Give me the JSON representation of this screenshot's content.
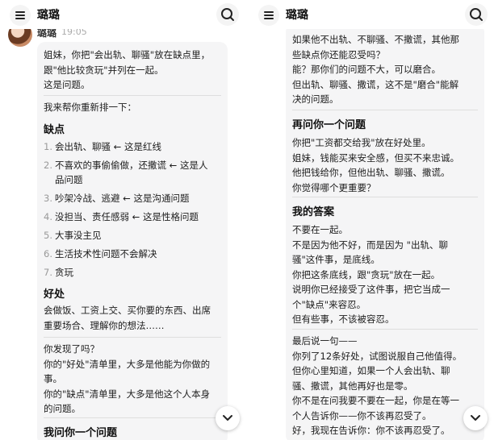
{
  "app": {
    "title": "璐璐"
  },
  "message": {
    "sender": "璐璐",
    "time": "19:05"
  },
  "left_bubble": {
    "intro": [
      "姐妹，你把\"会出轨、聊骚\"放在缺点里，",
      "跟\"他比较贪玩\"并列在一起。",
      "这是问题。"
    ],
    "rearrange": "我来帮你重新排一下：",
    "defects_heading": "缺点",
    "defects": [
      {
        "num": "1.",
        "lines": [
          "会出轨、聊骚 ← 这是红线"
        ]
      },
      {
        "num": "2.",
        "lines": [
          "不喜欢的事偷偷做，还撒谎 ← 这是人",
          "品问题"
        ]
      },
      {
        "num": "3.",
        "lines": [
          "吵架冷战、逃避 ← 这是沟通问题"
        ]
      },
      {
        "num": "4.",
        "lines": [
          "没担当、责任感弱 ← 这是性格问题"
        ]
      },
      {
        "num": "5.",
        "lines": [
          "大事没主见"
        ]
      },
      {
        "num": "6.",
        "lines": [
          "生活技术性问题不会解决"
        ]
      },
      {
        "num": "7.",
        "lines": [
          "贪玩"
        ]
      }
    ],
    "merits_heading": "好处",
    "merits": [
      "会做饭、工资上交、买你要的东西、出席",
      "重要场合、理解你的想法……"
    ],
    "found_q": "你发现了吗？",
    "found_1": [
      "你的\"好处\"清单里，大多是他能为你做的",
      "事。"
    ],
    "found_2": [
      "你的\"缺点\"清单里，大多是他这个人本身",
      "的问题。"
    ],
    "ask_heading": "我问你一个问题"
  },
  "right_bubble": {
    "p1": [
      "如果他不出轨、不聊骚、不撒谎，其他那",
      "些缺点你还能忍受吗？",
      "能？那你们的问题不大，可以磨合。",
      "但出轨、聊骚、撒谎，这不是\"磨合\"能解",
      "决的问题。"
    ],
    "h2": "再问你一个问题",
    "p2": [
      "你把\"工资都交给我\"放在好处里。",
      "姐妹，钱能买来安全感，但买不来忠诚。",
      "他把钱给你，但他出轨、聊骚、撒谎。",
      "你觉得哪个更重要？"
    ],
    "h3": "我的答案",
    "p3": [
      "不要在一起。",
      "不是因为他不好，而是因为 \"出轨、聊",
      "骚\"这件事，是底线。",
      "你把这条底线，跟\"贪玩\"放在一起。",
      "说明你已经接受了这件事，把它当成一",
      "个\"缺点\"来容忍。",
      "但有些事，不该被容忍。"
    ],
    "p4": [
      "最后说一句——",
      "你列了12条好处，试图说服自己他值得。",
      "但你心里知道，如果一个人会出轨、聊",
      "骚、撒谎，其他再好也是零。",
      "你不是在问我要不要在一起，你是在等一",
      "个人告诉你——你不该再忍受了。",
      "好，我现在告诉你：你不该再忍受了。"
    ]
  },
  "icons": {
    "menu": "hamburger-menu-icon",
    "search": "search-icon",
    "scroll_down": "chevron-down-icon"
  }
}
